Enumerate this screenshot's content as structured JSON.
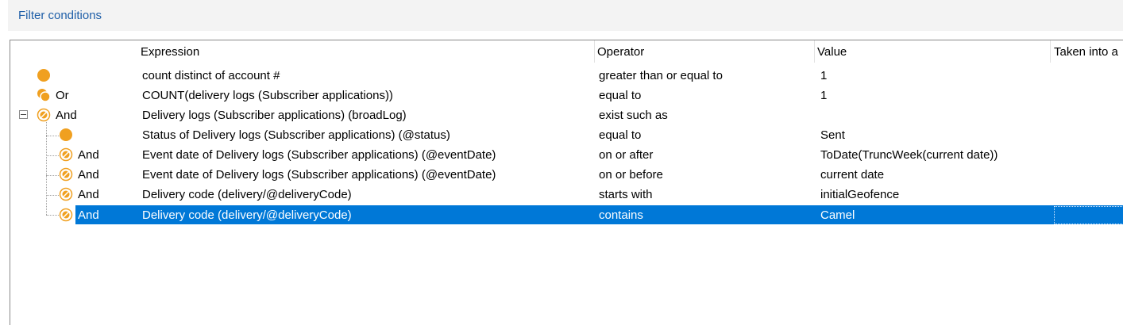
{
  "panel": {
    "title": "Filter conditions"
  },
  "columns": {
    "expression": "Expression",
    "operator": "Operator",
    "value": "Value",
    "taken": "Taken into a"
  },
  "rows": [
    {
      "logic": "",
      "expression": "count distinct of account #",
      "operator": "greater than or equal to",
      "value": "1"
    },
    {
      "logic": "Or",
      "expression": "COUNT(delivery logs (Subscriber applications))",
      "operator": "equal to",
      "value": "1"
    },
    {
      "logic": "And",
      "expression": "Delivery logs (Subscriber applications) (broadLog)",
      "operator": "exist such as",
      "value": ""
    },
    {
      "logic": "",
      "expression": "Status of Delivery logs (Subscriber applications) (@status)",
      "operator": "equal to",
      "value": "Sent"
    },
    {
      "logic": "And",
      "expression": "Event date of Delivery logs (Subscriber applications) (@eventDate)",
      "operator": "on or after",
      "value": "ToDate(TruncWeek(current date))"
    },
    {
      "logic": "And",
      "expression": "Event date of Delivery logs (Subscriber applications) (@eventDate)",
      "operator": "on or before",
      "value": "current date"
    },
    {
      "logic": "And",
      "expression": "Delivery code (delivery/@deliveryCode)",
      "operator": "starts with",
      "value": "initialGeofence"
    },
    {
      "logic": "And",
      "expression": "Delivery code (delivery/@deliveryCode)",
      "operator": "contains",
      "value": "Camel"
    }
  ],
  "colors": {
    "condition_icon": "#f0a020",
    "selection": "#0078d7",
    "title": "#1f5fa8"
  },
  "icons": {
    "simple_condition": "orange-dot-icon",
    "combined_condition": "combined-condition-icon",
    "collapse": "collapse-minus-icon"
  },
  "selected_row": 7
}
